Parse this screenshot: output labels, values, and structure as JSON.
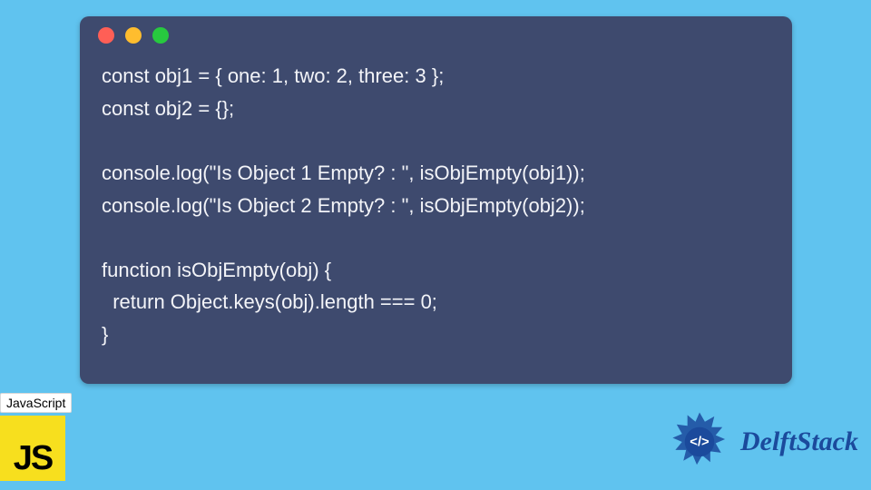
{
  "code": {
    "lines": [
      "const obj1 = { one: 1, two: 2, three: 3 };",
      "const obj2 = {};",
      "",
      "console.log(\"Is Object 1 Empty? : \", isObjEmpty(obj1));",
      "console.log(\"Is Object 2 Empty? : \", isObjEmpty(obj2));",
      "",
      "function isObjEmpty(obj) {",
      "  return Object.keys(obj).length === 0;",
      "}"
    ]
  },
  "window": {
    "dot_colors": {
      "red": "#ff5f56",
      "yellow": "#ffbd2e",
      "green": "#27c93f"
    },
    "background": "#3e4a6e"
  },
  "page_background": "#60c3ef",
  "js_badge": {
    "label": "JavaScript",
    "logo_text": "JS",
    "logo_bg": "#f7df1e"
  },
  "brand": {
    "name": "DelftStack",
    "color": "#1b4a9c"
  }
}
